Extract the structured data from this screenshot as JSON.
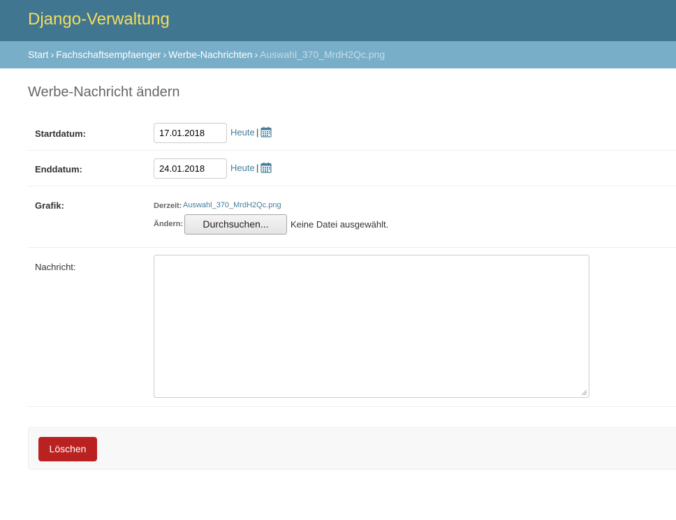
{
  "header": {
    "site_name": "Django-Verwaltung"
  },
  "breadcrumbs": {
    "items": [
      "Start",
      "Fachschaftsempfaenger",
      "Werbe-Nachrichten"
    ],
    "separator": "›",
    "current": "Auswahl_370_MrdH2Qc.png"
  },
  "page": {
    "title": "Werbe-Nachricht ändern"
  },
  "form": {
    "startdatum": {
      "label": "Startdatum:",
      "value": "17.01.2018",
      "today_link": "Heute",
      "divider": "|",
      "calendar_icon": "calendar-icon"
    },
    "enddatum": {
      "label": "Enddatum:",
      "value": "24.01.2018",
      "today_link": "Heute",
      "divider": "|",
      "calendar_icon": "calendar-icon"
    },
    "grafik": {
      "label": "Grafik:",
      "current_label": "Derzeit:",
      "current_file": "Auswahl_370_MrdH2Qc.png",
      "change_label": "Ändern:",
      "browse_button": "Durchsuchen...",
      "no_file_text": "Keine Datei ausgewählt."
    },
    "nachricht": {
      "label": "Nachricht:",
      "value": ""
    }
  },
  "submit_row": {
    "delete_button": "Löschen"
  },
  "colors": {
    "header_bg": "#417690",
    "site_name": "#f5dd5d",
    "breadcrumbs_bg": "#79aec8",
    "link": "#447e9b",
    "delete_bg": "#ba2121"
  }
}
